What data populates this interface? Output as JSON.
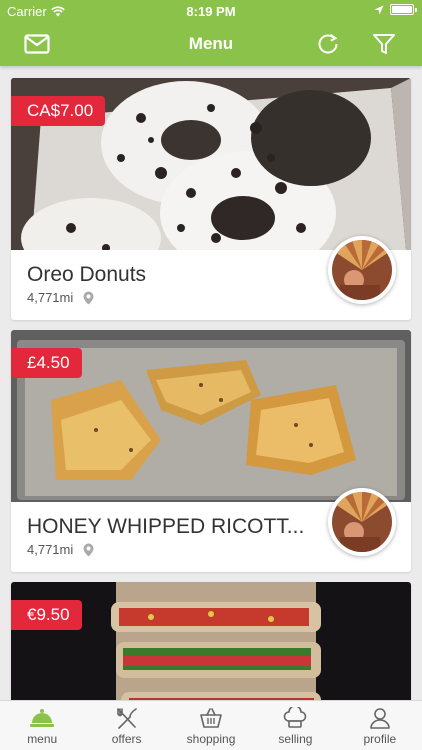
{
  "status_bar": {
    "carrier": "Carrier",
    "time": "8:19 PM"
  },
  "nav": {
    "title": "Menu"
  },
  "items": [
    {
      "price": "CA$7.00",
      "name": "Oreo Donuts",
      "distance": "4,771mi"
    },
    {
      "price": "£4.50",
      "name": "HONEY WHIPPED RICOTT...",
      "distance": "4,771mi"
    },
    {
      "price": "€9.50"
    }
  ],
  "tabs": [
    {
      "label": "menu",
      "icon": "cloche-icon"
    },
    {
      "label": "offers",
      "icon": "fork-knife-icon"
    },
    {
      "label": "shopping",
      "icon": "basket-icon"
    },
    {
      "label": "selling",
      "icon": "chef-hat-icon"
    },
    {
      "label": "profile",
      "icon": "person-icon"
    }
  ],
  "colors": {
    "primary": "#8bc34a",
    "price_tag": "#e3283c",
    "tab_background": "#f7f7f7"
  }
}
